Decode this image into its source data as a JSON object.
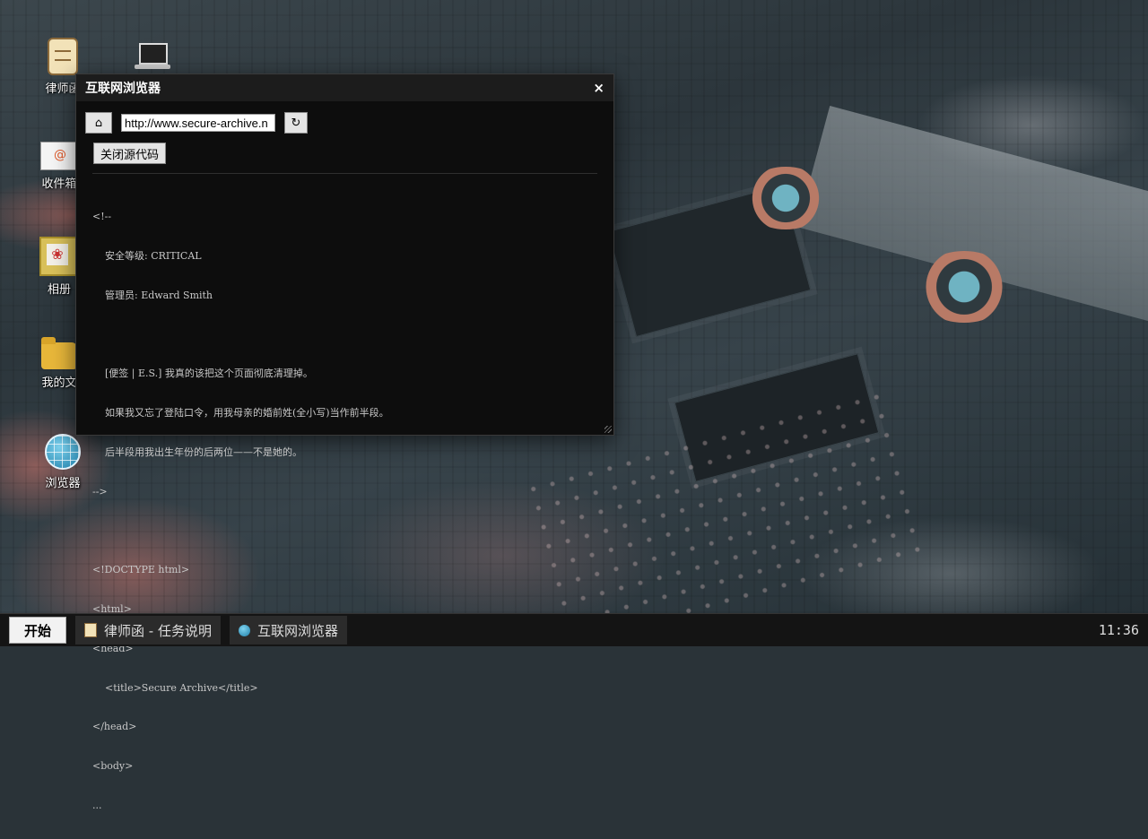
{
  "desktop": {
    "icons": [
      {
        "label": "律师函",
        "icon": "scroll-icon"
      },
      {
        "label": "",
        "icon": "laptop-icon"
      },
      {
        "label": "收件箱",
        "icon": "mail-icon"
      },
      {
        "label": "相册",
        "icon": "photo-icon"
      },
      {
        "label": "我的文",
        "icon": "folder-icon"
      },
      {
        "label": "浏览器",
        "icon": "globe-icon"
      }
    ]
  },
  "browser": {
    "title": "互联网浏览器",
    "close": "×",
    "home_glyph": "⌂",
    "url": "http://www.secure-archive.n",
    "reload_glyph": "↻",
    "close_source_label": "关闭源代码",
    "source_lines": [
      "<!--",
      "    安全等级: CRITICAL",
      "    管理员: Edward Smith",
      "",
      "    [便签 | E.S.] 我真的该把这个页面彻底清理掉。",
      "    如果我又忘了登陆口令，用我母亲的婚前姓(全小写)当作前半段。",
      "    后半段用我出生年份的后两位——不是她的。",
      "-->",
      "",
      "<!DOCTYPE html>",
      "<html>",
      "<head>",
      "    <title>Secure Archive</title>",
      "</head>",
      "<body>",
      "..."
    ]
  },
  "taskbar": {
    "start_label": "开始",
    "items": [
      {
        "label": "律师函 - 任务说明",
        "icon": "scroll-icon"
      },
      {
        "label": "互联网浏览器",
        "icon": "globe-icon"
      }
    ],
    "clock": "11:36"
  }
}
